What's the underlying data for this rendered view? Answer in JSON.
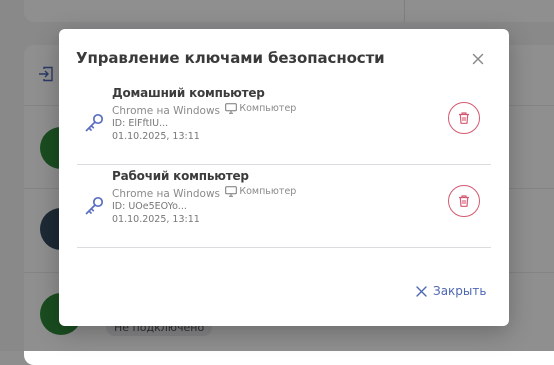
{
  "modal": {
    "title": "Управление ключами безопасности",
    "close_label": "Закрыть"
  },
  "keys": [
    {
      "name": "Домашний компьютер",
      "browser": "Chrome на Windows",
      "device": "Компьютер",
      "id": "ID: ElFftIU...",
      "date": "01.10.2025, 13:11"
    },
    {
      "name": "Рабочий компьютер",
      "browser": "Chrome на Windows",
      "device": "Компьютер",
      "id": "ID: UOe5EOYo...",
      "date": "01.10.2025, 13:11"
    }
  ],
  "background": {
    "status_tag": "Не подключено"
  },
  "colors": {
    "accent": "#4e67b5",
    "danger": "#d35a71",
    "key_icon": "#5a6fc0",
    "avatar_green": "#2f8a3a",
    "avatar_slate": "#34495e"
  },
  "icons": [
    "close-icon",
    "key-icon",
    "monitor-icon",
    "trash-icon",
    "login-icon"
  ]
}
